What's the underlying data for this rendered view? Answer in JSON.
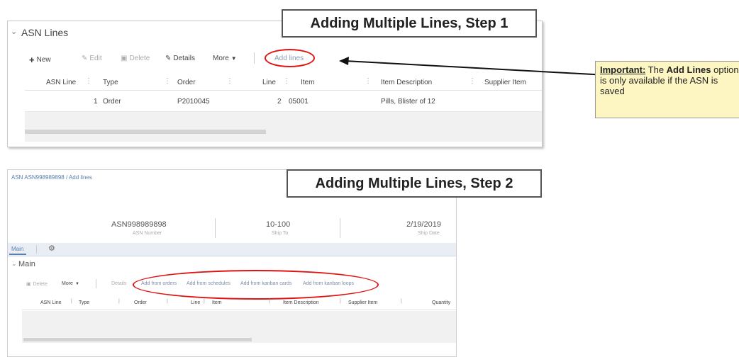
{
  "step1": {
    "callout": "Adding Multiple Lines, Step 1",
    "section_title": "ASN Lines",
    "toolbar": {
      "new": "New",
      "edit": "Edit",
      "delete": "Delete",
      "details": "Details",
      "more": "More",
      "add_lines": "Add lines"
    },
    "columns": [
      "ASN Line",
      "Type",
      "Order",
      "Line",
      "Item",
      "Item Description",
      "Supplier Item"
    ],
    "rows": [
      {
        "asn_line": "1",
        "type": "Order",
        "order": "P2010045",
        "line": "2",
        "item": "05001",
        "item_description": "Pills, Blister of 12",
        "supplier_item": ""
      }
    ]
  },
  "note": {
    "important": "Important:",
    "text1": " The ",
    "bold": "Add Lines",
    "text2": " option is only available if the ASN is saved"
  },
  "step2": {
    "callout": "Adding Multiple Lines, Step 2",
    "breadcrumb": "ASN ASN998989898 / Add lines",
    "asn_number": "ASN998989898",
    "asn_number_label": "ASN Number",
    "ship_to": "10-100",
    "ship_to_label": "Ship To",
    "ship_date": "2/19/2019",
    "ship_date_label": "Ship Date",
    "tab_main": "Main",
    "section_title": "Main",
    "toolbar": {
      "delete": "Delete",
      "more": "More",
      "details": "Details",
      "add_from_orders": "Add from orders",
      "add_from_schedules": "Add from schedules",
      "add_from_kanban_cards": "Add from kanban cards",
      "add_from_kanban_loops": "Add from kanban loops"
    },
    "columns": [
      "ASN Line",
      "Type",
      "Order",
      "Line",
      "Item",
      "Item Description",
      "Supplier Item",
      "Quantity"
    ]
  },
  "colors": {
    "highlight_ring": "#e01414",
    "note_bg": "#fdf6c3",
    "link_blue": "#5a7fb0"
  }
}
